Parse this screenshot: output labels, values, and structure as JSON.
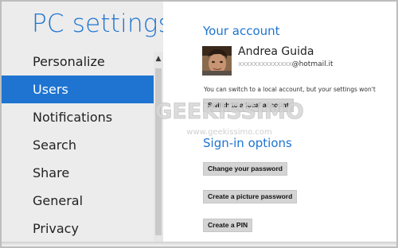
{
  "window": {
    "title": "PC settings"
  },
  "nav": {
    "items": [
      {
        "label": "Personalize",
        "selected": false
      },
      {
        "label": "Users",
        "selected": true
      },
      {
        "label": "Notifications",
        "selected": false
      },
      {
        "label": "Search",
        "selected": false
      },
      {
        "label": "Share",
        "selected": false
      },
      {
        "label": "General",
        "selected": false
      },
      {
        "label": "Privacy",
        "selected": false
      }
    ],
    "scroll_up_icon": "chevron-up-icon"
  },
  "account": {
    "heading": "Your account",
    "name": "Andrea Guida",
    "email_masked": "xxxxxxxxxxxxxx",
    "email_domain": "@hotmail.it",
    "description": "You can switch to a local account, but your settings won't",
    "switch_button": "Switch to a local account"
  },
  "signin": {
    "heading": "Sign-in options",
    "change_password_button": "Change your password",
    "picture_password_button": "Create a picture password",
    "pin_button": "Create a PIN"
  },
  "watermark": {
    "brand": "GEEKISSIMO",
    "url": "www.geekissimo.com"
  },
  "colors": {
    "accent": "#1e74d0",
    "nav_background": "#ececec",
    "button_background": "#d4d4d4"
  }
}
